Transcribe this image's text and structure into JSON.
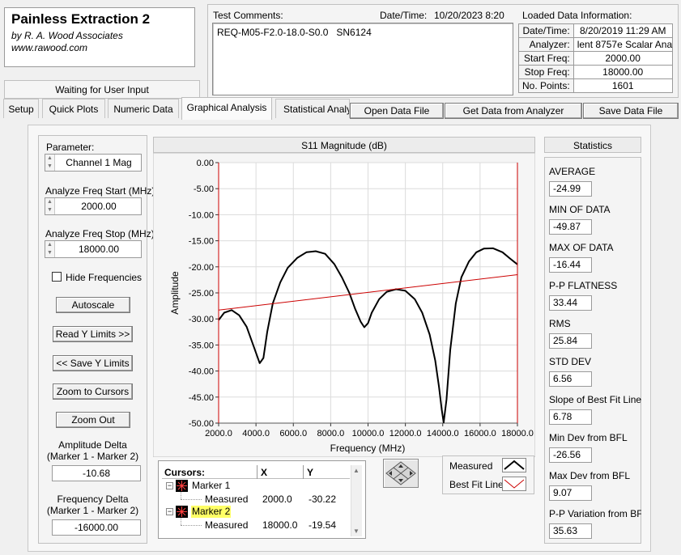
{
  "app": {
    "title": "Painless Extraction 2",
    "company": "by R. A. Wood Associates",
    "website": "www.rawood.com"
  },
  "status": "Waiting for User Input",
  "test_comments": {
    "label": "Test Comments:",
    "value": "REQ-M05-F2.0-18.0-S0.0   SN6124"
  },
  "datetime": {
    "label": "Date/Time:",
    "value": "10/20/2023  8:20"
  },
  "loaded_data": {
    "label": "Loaded Data Information:",
    "rows": [
      {
        "key": "Date/Time:",
        "value": "8/20/2019 11:29 AM"
      },
      {
        "key": "Analyzer:",
        "value": "lent 8757e Scalar Analy"
      },
      {
        "key": "Start Freq:",
        "value": "2000.00"
      },
      {
        "key": "Stop Freq:",
        "value": "18000.00"
      },
      {
        "key": "No. Points:",
        "value": "1601"
      }
    ]
  },
  "tabs": [
    "Setup",
    "Quick Plots",
    "Numeric Data",
    "Graphical Analysis",
    "Statistical Analy"
  ],
  "active_tab": "Graphical Analysis",
  "toolbar": {
    "open": "Open Data File",
    "get": "Get Data from Analyzer",
    "save": "Save Data File"
  },
  "left": {
    "parameter_label": "Parameter:",
    "parameter_value": "Channel 1 Mag",
    "start_label": "Analyze Freq Start (MHz)",
    "start_value": "2000.00",
    "stop_label": "Analyze Freq Stop (MHz)",
    "stop_value": "18000.00",
    "hide_freq": "Hide Frequencies",
    "hide_freq_checked": false,
    "autoscale": "Autoscale",
    "read_y": "Read Y Limits >>",
    "save_y": "<< Save Y Limits",
    "zoom_cursors": "Zoom to Cursors",
    "zoom_out": "Zoom Out",
    "amp_delta_label": "Amplitude Delta",
    "amp_delta_sub": "(Marker 1 - Marker 2)",
    "amp_delta_value": "-10.68",
    "freq_delta_label": "Frequency Delta",
    "freq_delta_sub": "(Marker 1 - Marker 2)",
    "freq_delta_value": "-16000.00"
  },
  "chart_data": {
    "type": "line",
    "title": "S11 Magnitude (dB)",
    "xlabel": "Frequency (MHz)",
    "ylabel": "Amplitude",
    "xlim": [
      2000,
      18000
    ],
    "ylim": [
      -50,
      0
    ],
    "x_ticks": [
      "2000.0",
      "4000.0",
      "6000.0",
      "8000.0",
      "10000.0",
      "12000.0",
      "14000.0",
      "16000.0",
      "18000.0"
    ],
    "y_ticks": [
      "0.00",
      "-5.00",
      "-10.00",
      "-15.00",
      "-20.00",
      "-25.00",
      "-30.00",
      "-35.00",
      "-40.00",
      "-45.00",
      "-50.00"
    ],
    "grid": true,
    "series": [
      {
        "name": "Measured",
        "color": "#000000",
        "x": [
          2000,
          2300,
          2700,
          3100,
          3500,
          3900,
          4200,
          4400,
          4600,
          4900,
          5300,
          5700,
          6200,
          6700,
          7200,
          7700,
          8200,
          8600,
          9000,
          9300,
          9600,
          9800,
          10000,
          10200,
          10600,
          11000,
          11500,
          12000,
          12500,
          12900,
          13300,
          13600,
          13800,
          13950,
          14050,
          14200,
          14400,
          14700,
          15000,
          15400,
          15800,
          16200,
          16700,
          17200,
          17600,
          18000
        ],
        "y": [
          -30.22,
          -28.8,
          -28.3,
          -29.3,
          -31.5,
          -35.5,
          -38.5,
          -37.5,
          -32.5,
          -27.0,
          -23.0,
          -20.2,
          -18.3,
          -17.2,
          -17.0,
          -17.5,
          -19.5,
          -22.0,
          -25.0,
          -28.0,
          -30.5,
          -31.6,
          -30.8,
          -28.8,
          -26.2,
          -24.8,
          -24.3,
          -24.6,
          -26.2,
          -28.8,
          -33.0,
          -38.0,
          -43.0,
          -47.5,
          -49.87,
          -45.5,
          -36.0,
          -27.0,
          -22.0,
          -19.0,
          -17.2,
          -16.5,
          -16.44,
          -17.2,
          -18.4,
          -19.54
        ]
      },
      {
        "name": "Best Fit Line",
        "color": "#cc0000",
        "x": [
          2000,
          18000
        ],
        "y": [
          -28.3,
          -21.5
        ]
      }
    ]
  },
  "legend": {
    "measured": "Measured",
    "bestfit": "Best Fit Line"
  },
  "cursors": {
    "header": [
      "Cursors:",
      "X",
      "Y"
    ],
    "items": [
      {
        "name": "Marker 1",
        "sub": "Measured",
        "x": "2000.0",
        "y": "-30.22",
        "highlight": false
      },
      {
        "name": "Marker 2",
        "sub": "Measured",
        "x": "18000.0",
        "y": "-19.54",
        "highlight": true
      }
    ]
  },
  "statistics": {
    "title": "Statistics",
    "items": [
      {
        "label": "AVERAGE",
        "value": "-24.99"
      },
      {
        "label": "MIN OF DATA",
        "value": "-49.87"
      },
      {
        "label": "MAX OF DATA",
        "value": "-16.44"
      },
      {
        "label": "P-P FLATNESS",
        "value": "33.44"
      },
      {
        "label": "RMS",
        "value": "25.84"
      },
      {
        "label": "STD DEV",
        "value": "6.56"
      },
      {
        "label": "Slope of Best Fit Line",
        "value": "6.78"
      },
      {
        "label": "Min Dev from BFL",
        "value": "-26.56"
      },
      {
        "label": "Max Dev from BFL",
        "value": "9.07"
      },
      {
        "label": "P-P Variation from BF",
        "value": "35.63"
      }
    ]
  },
  "colors": {
    "measured": "#000000",
    "bestfit": "#cc0000",
    "highlight": "#ffff66",
    "background": "#f0f0f0"
  }
}
